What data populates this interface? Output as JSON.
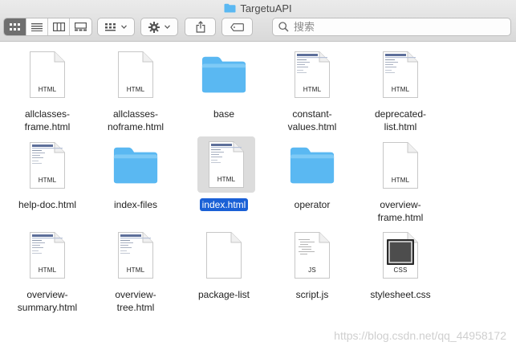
{
  "window": {
    "title": "TargetuAPI"
  },
  "toolbar": {
    "view_buttons": [
      "icon-view",
      "list-view",
      "column-view",
      "gallery-view"
    ],
    "search": {
      "placeholder": "搜索",
      "value": ""
    }
  },
  "files": [
    {
      "name": "allclasses-\nframe.html",
      "kind": "html",
      "badge": "HTML",
      "preview": false
    },
    {
      "name": "allclasses-\nnoframe.html",
      "kind": "html",
      "badge": "HTML",
      "preview": false
    },
    {
      "name": "base",
      "kind": "folder"
    },
    {
      "name": "constant-\nvalues.html",
      "kind": "html",
      "badge": "HTML",
      "preview": true
    },
    {
      "name": "deprecated-\nlist.html",
      "kind": "html",
      "badge": "HTML",
      "preview": true
    },
    {
      "name": "help-doc.html",
      "kind": "html",
      "badge": "HTML",
      "preview": true
    },
    {
      "name": "index-files",
      "kind": "folder"
    },
    {
      "name": "index.html",
      "kind": "html",
      "badge": "HTML",
      "preview": true,
      "selected": true
    },
    {
      "name": "operator",
      "kind": "folder"
    },
    {
      "name": "overview-\nframe.html",
      "kind": "html",
      "badge": "HTML",
      "preview": false
    },
    {
      "name": "overview-\nsummary.html",
      "kind": "html",
      "badge": "HTML",
      "preview": true
    },
    {
      "name": "overview-\ntree.html",
      "kind": "html",
      "badge": "HTML",
      "preview": true
    },
    {
      "name": "package-list",
      "kind": "blank"
    },
    {
      "name": "script.js",
      "kind": "js",
      "badge": "JS"
    },
    {
      "name": "stylesheet.css",
      "kind": "css",
      "badge": "CSS"
    }
  ],
  "watermark": "https://blog.csdn.net/qq_44958172",
  "colors": {
    "folder": "#5ab8f2",
    "selection": "#1a60d6"
  }
}
